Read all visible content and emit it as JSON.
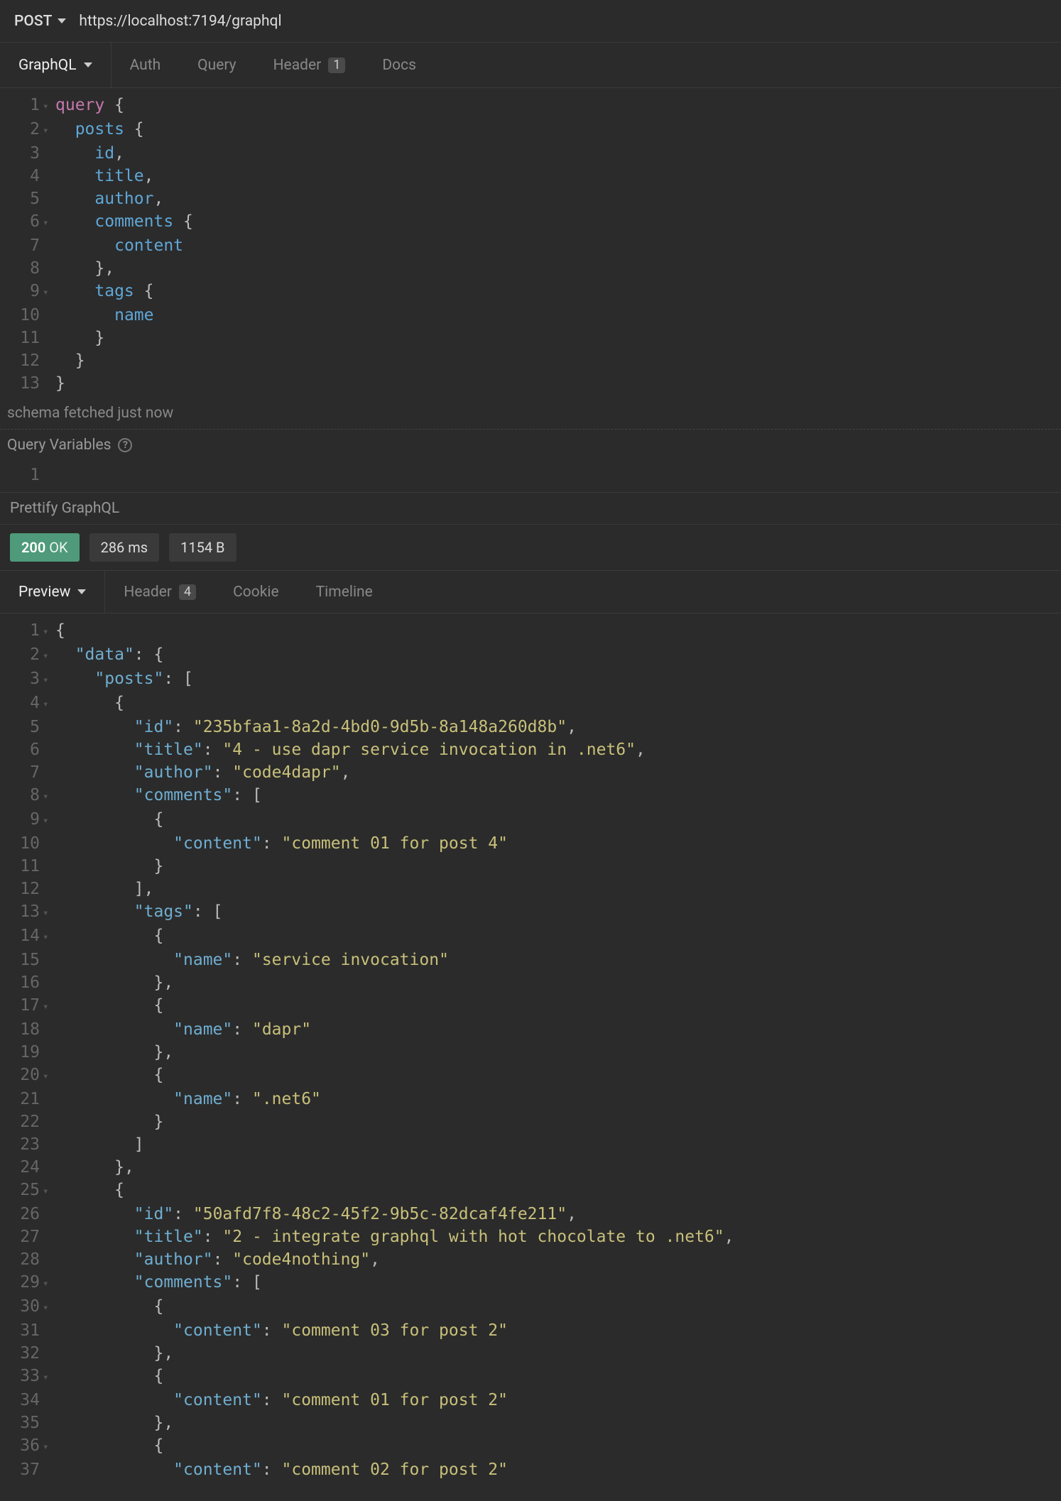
{
  "request": {
    "method": "POST",
    "url": "https://localhost:7194/graphql"
  },
  "reqTabs": {
    "active": "GraphQL",
    "items": [
      {
        "id": "graphql",
        "label": "GraphQL"
      },
      {
        "id": "auth",
        "label": "Auth"
      },
      {
        "id": "query",
        "label": "Query"
      },
      {
        "id": "header",
        "label": "Header",
        "badge": "1"
      },
      {
        "id": "docs",
        "label": "Docs"
      }
    ]
  },
  "queryEditor": {
    "lines": [
      {
        "n": "1",
        "fold": "▾",
        "tokens": [
          [
            "kw",
            "query"
          ],
          [
            "pn",
            " {"
          ]
        ]
      },
      {
        "n": "2",
        "fold": "▾",
        "tokens": [
          [
            "txt",
            "  "
          ],
          [
            "fld",
            "posts"
          ],
          [
            "pn",
            " {"
          ]
        ]
      },
      {
        "n": "3",
        "fold": "",
        "tokens": [
          [
            "txt",
            "    "
          ],
          [
            "fld",
            "id"
          ],
          [
            "pn",
            ","
          ]
        ]
      },
      {
        "n": "4",
        "fold": "",
        "tokens": [
          [
            "txt",
            "    "
          ],
          [
            "fld",
            "title"
          ],
          [
            "pn",
            ","
          ]
        ]
      },
      {
        "n": "5",
        "fold": "",
        "tokens": [
          [
            "txt",
            "    "
          ],
          [
            "fld",
            "author"
          ],
          [
            "pn",
            ","
          ]
        ]
      },
      {
        "n": "6",
        "fold": "▾",
        "tokens": [
          [
            "txt",
            "    "
          ],
          [
            "fld",
            "comments"
          ],
          [
            "pn",
            " {"
          ]
        ]
      },
      {
        "n": "7",
        "fold": "",
        "tokens": [
          [
            "txt",
            "      "
          ],
          [
            "fld",
            "content"
          ]
        ]
      },
      {
        "n": "8",
        "fold": "",
        "tokens": [
          [
            "txt",
            "    "
          ],
          [
            "pn",
            "},"
          ]
        ]
      },
      {
        "n": "9",
        "fold": "▾",
        "tokens": [
          [
            "txt",
            "    "
          ],
          [
            "fld",
            "tags"
          ],
          [
            "pn",
            " {"
          ]
        ]
      },
      {
        "n": "10",
        "fold": "",
        "tokens": [
          [
            "txt",
            "      "
          ],
          [
            "fld",
            "name"
          ]
        ]
      },
      {
        "n": "11",
        "fold": "",
        "tokens": [
          [
            "txt",
            "    "
          ],
          [
            "pn",
            "}"
          ]
        ]
      },
      {
        "n": "12",
        "fold": "",
        "tokens": [
          [
            "txt",
            "  "
          ],
          [
            "pn",
            "}"
          ]
        ]
      },
      {
        "n": "13",
        "fold": "",
        "tokens": [
          [
            "pn",
            "}"
          ]
        ]
      }
    ],
    "schemaStatus": "schema fetched just now",
    "varsTitle": "Query Variables",
    "varsLines": [
      {
        "n": "1",
        "fold": "",
        "tokens": [
          [
            "txt",
            ""
          ]
        ]
      }
    ],
    "prettify": "Prettify GraphQL"
  },
  "response": {
    "statusCode": "200",
    "statusText": "OK",
    "time": "286 ms",
    "size": "1154 B",
    "tabs": {
      "active": "Preview",
      "items": [
        {
          "id": "preview",
          "label": "Preview"
        },
        {
          "id": "header",
          "label": "Header",
          "badge": "4"
        },
        {
          "id": "cookie",
          "label": "Cookie"
        },
        {
          "id": "timeline",
          "label": "Timeline"
        }
      ]
    },
    "lines": [
      {
        "n": "1",
        "fold": "▾",
        "tokens": [
          [
            "pn",
            "{"
          ]
        ]
      },
      {
        "n": "2",
        "fold": "▾",
        "tokens": [
          [
            "txt",
            "  "
          ],
          [
            "key",
            "\"data\""
          ],
          [
            "pn",
            ": {"
          ]
        ]
      },
      {
        "n": "3",
        "fold": "▾",
        "tokens": [
          [
            "txt",
            "    "
          ],
          [
            "key",
            "\"posts\""
          ],
          [
            "pn",
            ": ["
          ]
        ]
      },
      {
        "n": "4",
        "fold": "▾",
        "tokens": [
          [
            "txt",
            "      "
          ],
          [
            "pn",
            "{"
          ]
        ]
      },
      {
        "n": "5",
        "fold": "",
        "tokens": [
          [
            "txt",
            "        "
          ],
          [
            "key",
            "\"id\""
          ],
          [
            "pn",
            ": "
          ],
          [
            "str",
            "\"235bfaa1-8a2d-4bd0-9d5b-8a148a260d8b\""
          ],
          [
            "pn",
            ","
          ]
        ]
      },
      {
        "n": "6",
        "fold": "",
        "tokens": [
          [
            "txt",
            "        "
          ],
          [
            "key",
            "\"title\""
          ],
          [
            "pn",
            ": "
          ],
          [
            "str",
            "\"4 - use dapr service invocation in .net6\""
          ],
          [
            "pn",
            ","
          ]
        ]
      },
      {
        "n": "7",
        "fold": "",
        "tokens": [
          [
            "txt",
            "        "
          ],
          [
            "key",
            "\"author\""
          ],
          [
            "pn",
            ": "
          ],
          [
            "str",
            "\"code4dapr\""
          ],
          [
            "pn",
            ","
          ]
        ]
      },
      {
        "n": "8",
        "fold": "▾",
        "tokens": [
          [
            "txt",
            "        "
          ],
          [
            "key",
            "\"comments\""
          ],
          [
            "pn",
            ": ["
          ]
        ]
      },
      {
        "n": "9",
        "fold": "▾",
        "tokens": [
          [
            "txt",
            "          "
          ],
          [
            "pn",
            "{"
          ]
        ]
      },
      {
        "n": "10",
        "fold": "",
        "tokens": [
          [
            "txt",
            "            "
          ],
          [
            "key",
            "\"content\""
          ],
          [
            "pn",
            ": "
          ],
          [
            "str",
            "\"comment 01 for post 4\""
          ]
        ]
      },
      {
        "n": "11",
        "fold": "",
        "tokens": [
          [
            "txt",
            "          "
          ],
          [
            "pn",
            "}"
          ]
        ]
      },
      {
        "n": "12",
        "fold": "",
        "tokens": [
          [
            "txt",
            "        "
          ],
          [
            "pn",
            "],"
          ]
        ]
      },
      {
        "n": "13",
        "fold": "▾",
        "tokens": [
          [
            "txt",
            "        "
          ],
          [
            "key",
            "\"tags\""
          ],
          [
            "pn",
            ": ["
          ]
        ]
      },
      {
        "n": "14",
        "fold": "▾",
        "tokens": [
          [
            "txt",
            "          "
          ],
          [
            "pn",
            "{"
          ]
        ]
      },
      {
        "n": "15",
        "fold": "",
        "tokens": [
          [
            "txt",
            "            "
          ],
          [
            "key",
            "\"name\""
          ],
          [
            "pn",
            ": "
          ],
          [
            "str",
            "\"service invocation\""
          ]
        ]
      },
      {
        "n": "16",
        "fold": "",
        "tokens": [
          [
            "txt",
            "          "
          ],
          [
            "pn",
            "},"
          ]
        ]
      },
      {
        "n": "17",
        "fold": "▾",
        "tokens": [
          [
            "txt",
            "          "
          ],
          [
            "pn",
            "{"
          ]
        ]
      },
      {
        "n": "18",
        "fold": "",
        "tokens": [
          [
            "txt",
            "            "
          ],
          [
            "key",
            "\"name\""
          ],
          [
            "pn",
            ": "
          ],
          [
            "str",
            "\"dapr\""
          ]
        ]
      },
      {
        "n": "19",
        "fold": "",
        "tokens": [
          [
            "txt",
            "          "
          ],
          [
            "pn",
            "},"
          ]
        ]
      },
      {
        "n": "20",
        "fold": "▾",
        "tokens": [
          [
            "txt",
            "          "
          ],
          [
            "pn",
            "{"
          ]
        ]
      },
      {
        "n": "21",
        "fold": "",
        "tokens": [
          [
            "txt",
            "            "
          ],
          [
            "key",
            "\"name\""
          ],
          [
            "pn",
            ": "
          ],
          [
            "str",
            "\".net6\""
          ]
        ]
      },
      {
        "n": "22",
        "fold": "",
        "tokens": [
          [
            "txt",
            "          "
          ],
          [
            "pn",
            "}"
          ]
        ]
      },
      {
        "n": "23",
        "fold": "",
        "tokens": [
          [
            "txt",
            "        "
          ],
          [
            "pn",
            "]"
          ]
        ]
      },
      {
        "n": "24",
        "fold": "",
        "tokens": [
          [
            "txt",
            "      "
          ],
          [
            "pn",
            "},"
          ]
        ]
      },
      {
        "n": "25",
        "fold": "▾",
        "tokens": [
          [
            "txt",
            "      "
          ],
          [
            "pn",
            "{"
          ]
        ]
      },
      {
        "n": "26",
        "fold": "",
        "tokens": [
          [
            "txt",
            "        "
          ],
          [
            "key",
            "\"id\""
          ],
          [
            "pn",
            ": "
          ],
          [
            "str",
            "\"50afd7f8-48c2-45f2-9b5c-82dcaf4fe211\""
          ],
          [
            "pn",
            ","
          ]
        ]
      },
      {
        "n": "27",
        "fold": "",
        "tokens": [
          [
            "txt",
            "        "
          ],
          [
            "key",
            "\"title\""
          ],
          [
            "pn",
            ": "
          ],
          [
            "str",
            "\"2 - integrate graphql with hot chocolate to .net6\""
          ],
          [
            "pn",
            ","
          ]
        ]
      },
      {
        "n": "28",
        "fold": "",
        "tokens": [
          [
            "txt",
            "        "
          ],
          [
            "key",
            "\"author\""
          ],
          [
            "pn",
            ": "
          ],
          [
            "str",
            "\"code4nothing\""
          ],
          [
            "pn",
            ","
          ]
        ]
      },
      {
        "n": "29",
        "fold": "▾",
        "tokens": [
          [
            "txt",
            "        "
          ],
          [
            "key",
            "\"comments\""
          ],
          [
            "pn",
            ": ["
          ]
        ]
      },
      {
        "n": "30",
        "fold": "▾",
        "tokens": [
          [
            "txt",
            "          "
          ],
          [
            "pn",
            "{"
          ]
        ]
      },
      {
        "n": "31",
        "fold": "",
        "tokens": [
          [
            "txt",
            "            "
          ],
          [
            "key",
            "\"content\""
          ],
          [
            "pn",
            ": "
          ],
          [
            "str",
            "\"comment 03 for post 2\""
          ]
        ]
      },
      {
        "n": "32",
        "fold": "",
        "tokens": [
          [
            "txt",
            "          "
          ],
          [
            "pn",
            "},"
          ]
        ]
      },
      {
        "n": "33",
        "fold": "▾",
        "tokens": [
          [
            "txt",
            "          "
          ],
          [
            "pn",
            "{"
          ]
        ]
      },
      {
        "n": "34",
        "fold": "",
        "tokens": [
          [
            "txt",
            "            "
          ],
          [
            "key",
            "\"content\""
          ],
          [
            "pn",
            ": "
          ],
          [
            "str",
            "\"comment 01 for post 2\""
          ]
        ]
      },
      {
        "n": "35",
        "fold": "",
        "tokens": [
          [
            "txt",
            "          "
          ],
          [
            "pn",
            "},"
          ]
        ]
      },
      {
        "n": "36",
        "fold": "▾",
        "tokens": [
          [
            "txt",
            "          "
          ],
          [
            "pn",
            "{"
          ]
        ]
      },
      {
        "n": "37",
        "fold": "",
        "tokens": [
          [
            "txt",
            "            "
          ],
          [
            "key",
            "\"content\""
          ],
          [
            "pn",
            ": "
          ],
          [
            "str",
            "\"comment 02 for post 2\""
          ]
        ]
      }
    ]
  }
}
